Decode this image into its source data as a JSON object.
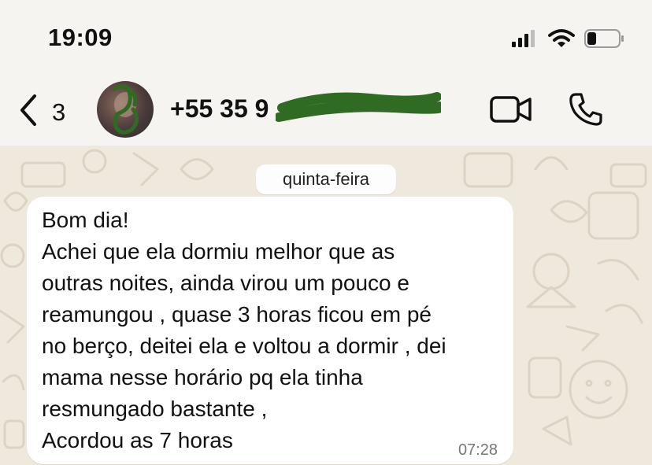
{
  "status_bar": {
    "time": "19:09",
    "icons": [
      "signal-icon",
      "wifi-icon",
      "battery-icon"
    ]
  },
  "header": {
    "back_count": "3",
    "contact_name": "+55 35 9",
    "icons": [
      "back-chevron-icon",
      "avatar",
      "video-call-icon",
      "phone-icon"
    ]
  },
  "chat": {
    "date_separator": "quinta-feira",
    "message": {
      "lines": [
        "Bom dia!",
        "Achei que ela dormiu melhor que as",
        "outras noites, ainda virou um pouco e",
        "reamungou , quase 3 horas ficou em pé",
        "no berço, deitei ela e voltou a dormir ,  dei",
        "mama nesse horário pq ela tinha",
        "resmungado bastante ,",
        "Acordou as 7 horas"
      ],
      "time": "07:28"
    }
  },
  "colors": {
    "header_bg": "#f6f4f1",
    "chat_bg": "#efe8dc",
    "bubble_bg": "#ffffff",
    "redaction": "#2f6b22"
  }
}
